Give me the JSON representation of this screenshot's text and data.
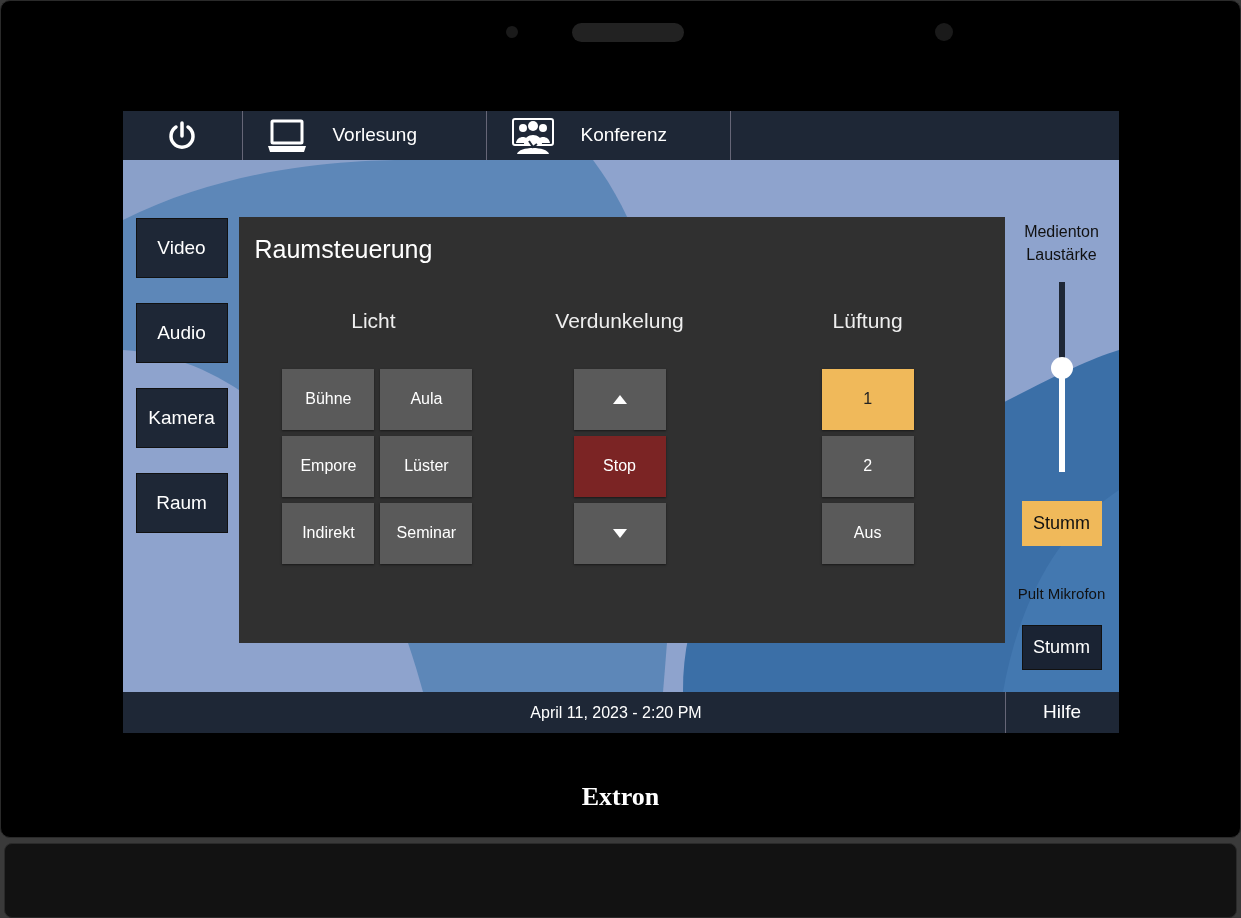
{
  "top_bar": {
    "modes": [
      {
        "label": "Vorlesung",
        "kind": "laptop"
      },
      {
        "label": "Konferenz",
        "kind": "group"
      }
    ]
  },
  "nav": [
    {
      "label": "Video"
    },
    {
      "label": "Audio"
    },
    {
      "label": "Kamera"
    },
    {
      "label": "Raum"
    }
  ],
  "panel": {
    "title": "Raumsteuerung",
    "light": {
      "heading": "Licht",
      "buttons": [
        {
          "label": "Bühne"
        },
        {
          "label": "Aula"
        },
        {
          "label": "Empore"
        },
        {
          "label": "Lüster"
        },
        {
          "label": "Indirekt"
        },
        {
          "label": "Seminar"
        }
      ]
    },
    "shades": {
      "heading": "Verdunkelung",
      "buttons": [
        {
          "kind": "up"
        },
        {
          "kind": "stop",
          "label": "Stop"
        },
        {
          "kind": "down"
        }
      ]
    },
    "ventilation": {
      "heading": "Lüftung",
      "buttons": [
        {
          "label": "1",
          "selected": true
        },
        {
          "label": "2",
          "selected": false
        },
        {
          "label": "Aus",
          "selected": false
        }
      ]
    }
  },
  "volume": {
    "label_lines": [
      "Medienton",
      "Laustärke"
    ],
    "level": 0.55,
    "mute": {
      "label": "Stumm",
      "on": true
    }
  },
  "microphone": {
    "label": "Pult Mikrofon",
    "mute": {
      "label": "Stumm",
      "on": false
    }
  },
  "status_bar": {
    "datetime": "April 11, 2023 - 2:20 PM",
    "help": "Hilfe"
  },
  "device": {
    "logo": "Extron"
  }
}
